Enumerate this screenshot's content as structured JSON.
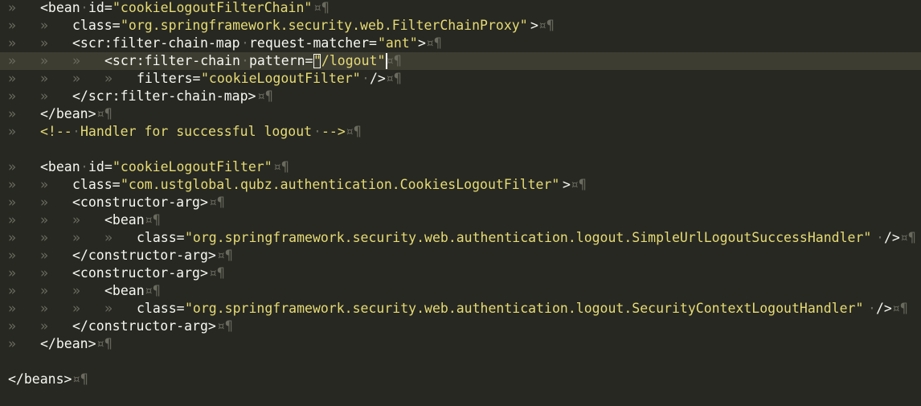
{
  "editor": {
    "theme_colors": {
      "background": "#272822",
      "current_line": "#3E3D32",
      "text": "#F8F8F2",
      "string": "#E6DB74",
      "comment": "#E6DB74",
      "invisibles": "#6A6A5E"
    },
    "symbols": {
      "tab_marker": "»",
      "space_marker": "·",
      "eol_marker": "¤¶"
    },
    "lines": [
      {
        "text_tag": "<bean",
        "text_attr": "id=",
        "text_str": "\"cookieLogoutFilterChain\""
      },
      {
        "text_attr": "class=",
        "text_str": "\"org.springframework.security.web.FilterChainProxy\"",
        "text_end": ">"
      },
      {
        "text_tag": "<scr:filter-chain-map",
        "text_attr": "request-matcher=",
        "text_str": "\"ant\"",
        "text_end": ">"
      },
      {
        "text_tag": "<scr:filter-chain",
        "text_attr": "pattern=",
        "text_str": "\"/logout\""
      },
      {
        "text_attr": "filters=",
        "text_str": "\"cookieLogoutFilter\"",
        "text_end": "/>"
      },
      {
        "text_tag": "</scr:filter-chain-map>"
      },
      {
        "text_tag": "</bean>"
      },
      {
        "text_cmt_open": "<!--",
        "text_cmt_body": "Handler for successful logout",
        "text_cmt_close": "-->"
      },
      {},
      {
        "text_tag": "<bean",
        "text_attr": "id=",
        "text_str": "\"cookieLogoutFilter\""
      },
      {
        "text_attr": "class=",
        "text_str": "\"com.ustglobal.qubz.authentication.CookiesLogoutFilter\"",
        "text_end": ">"
      },
      {
        "text_tag": "<constructor-arg>"
      },
      {
        "text_tag": "<bean"
      },
      {
        "text_attr": "class=",
        "text_str": "\"org.springframework.security.web.authentication.logout.SimpleUrlLogoutSuccessHandler\"",
        "text_end": "/>"
      },
      {
        "text_tag": "</constructor-arg>"
      },
      {
        "text_tag": "<constructor-arg>"
      },
      {
        "text_tag": "<bean"
      },
      {
        "text_attr": "class=",
        "text_str": "\"org.springframework.security.web.authentication.logout.SecurityContextLogoutHandler\"",
        "text_end": "/>"
      },
      {
        "text_tag": "</constructor-arg>"
      },
      {
        "text_tag": "</bean>"
      },
      {},
      {
        "text_tag": "</beans>"
      }
    ]
  }
}
